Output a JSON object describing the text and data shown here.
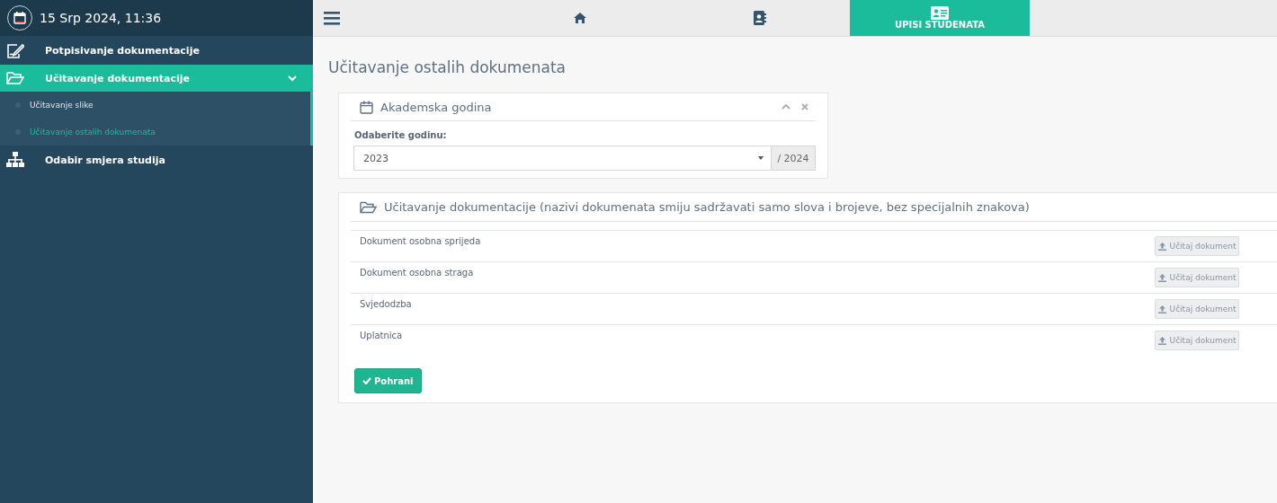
{
  "sidebar": {
    "datetime": "15 Srp 2024, 11:36",
    "items": [
      {
        "kind": "sign",
        "label": "Potpisivanje dokumentacije",
        "selected": false
      },
      {
        "kind": "folder",
        "label": "Učitavanje dokumentacije",
        "selected": true,
        "expanded": true,
        "children": [
          {
            "label": "Učitavanje slike",
            "selected": false
          },
          {
            "label": "Učitavanje ostalih dokumenata",
            "selected": true
          }
        ]
      },
      {
        "kind": "tree",
        "label": "Odabir smjera studija",
        "selected": false
      }
    ]
  },
  "top_bar": {
    "tabs": [
      {
        "kind": "home",
        "selected": false
      },
      {
        "kind": "contacts",
        "selected": false
      },
      {
        "kind": "card",
        "label": "UPISI STUDENATA",
        "selected": true
      }
    ]
  },
  "page_title": "Učitavanje ostalih dokumenata",
  "year_panel": {
    "title": "Akademska godina",
    "field_label": "Odaberite godinu:",
    "value": "2023",
    "suffix": "/ 2024"
  },
  "documents_panel": {
    "title": "Učitavanje dokumentacije (nazivi dokumenata smiju sadržavati samo slova i brojeve, bez specijalnih znakova)",
    "rows": [
      {
        "name": "Dokument osobna sprijeda",
        "button": "Učitaj dokument"
      },
      {
        "name": "Dokument osobna straga",
        "button": "Učitaj dokument"
      },
      {
        "name": "Svjedodzba",
        "button": "Učitaj dokument"
      },
      {
        "name": "Uplatnica",
        "button": "Učitaj dokument"
      }
    ],
    "save_button": "Pohrani"
  }
}
